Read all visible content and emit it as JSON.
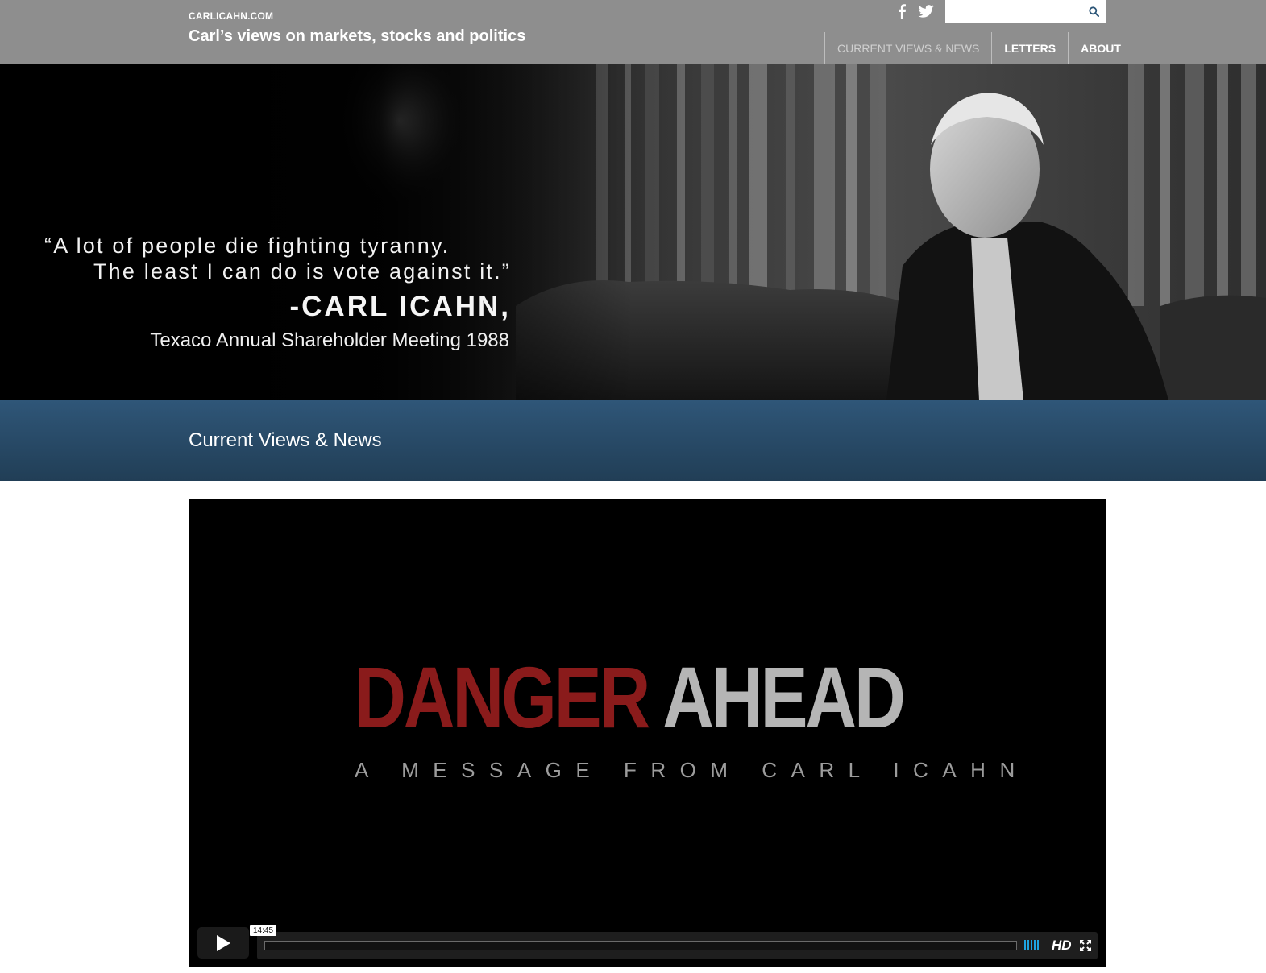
{
  "header": {
    "site_name": "CARLICAHN.COM",
    "tagline": "Carl’s views on markets, stocks and politics",
    "search": {
      "value": "",
      "placeholder": ""
    },
    "nav": [
      {
        "label": "CURRENT VIEWS & NEWS",
        "active": true
      },
      {
        "label": "LETTERS",
        "active": false
      },
      {
        "label": "ABOUT",
        "active": false
      }
    ],
    "icons": {
      "facebook": "facebook-icon",
      "twitter": "twitter-icon",
      "search": "search-icon"
    }
  },
  "hero": {
    "quote_line_1": "“A lot of people die fighting tyranny.",
    "quote_line_2": "The least I can do is vote against it.”",
    "author": "-CARL ICAHN,",
    "source": "Texaco Annual Shareholder Meeting 1988"
  },
  "section": {
    "title": "Current Views & News"
  },
  "video": {
    "title_part_1": "DANGER",
    "title_part_2": "AHEAD",
    "subtitle": "A MESSAGE FROM CARL ICAHN",
    "duration": "14:45",
    "hd_label": "HD",
    "progress": 0,
    "colors": {
      "title_red": "#8a1b1b",
      "title_gray": "#b5b5b5",
      "volume": "#1ea4e0"
    }
  },
  "colors": {
    "header_bg": "#8e8e8e",
    "band_top": "#2f5678",
    "band_bottom": "#213e56"
  }
}
